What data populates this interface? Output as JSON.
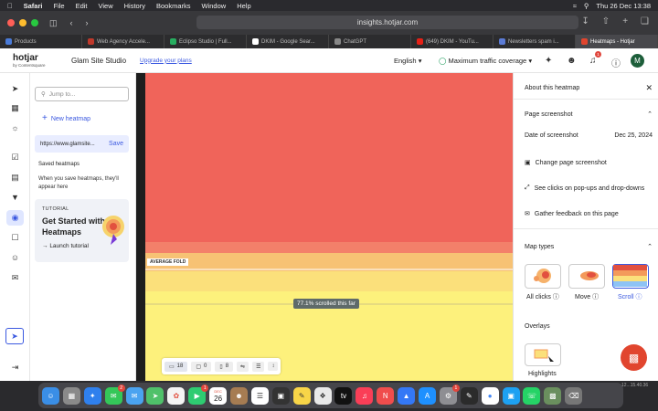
{
  "menubar": {
    "app": "Safari",
    "items": [
      "File",
      "Edit",
      "View",
      "History",
      "Bookmarks",
      "Window",
      "Help"
    ],
    "clock": "Thu 26 Dec  13:38"
  },
  "browser": {
    "url": "insights.hotjar.com",
    "tabs": [
      {
        "label": "Products",
        "color": "#4a7bd8"
      },
      {
        "label": "Web Agency Accele...",
        "color": "#c0392b"
      },
      {
        "label": "Eclipso Studio | Full...",
        "color": "#27ae60"
      },
      {
        "label": "DKIM - Google Sear...",
        "color": "#ffffff"
      },
      {
        "label": "ChatGPT",
        "color": "#888888"
      },
      {
        "label": "(649) DKIM - YouTu...",
        "color": "#e62117"
      },
      {
        "label": "Newsletters spam i...",
        "color": "#5b7bd5"
      },
      {
        "label": "Heatmaps - Hotjar",
        "color": "#e1452e"
      }
    ]
  },
  "header": {
    "logo_main": "hotjar",
    "logo_sub": "by Contentsquare",
    "site_name": "Glam Site Studio",
    "upgrade_link": "Upgrade your plans",
    "language": "English",
    "coverage": "Maximum traffic coverage",
    "notification_count": "1",
    "avatar_initial": "M"
  },
  "sidebar": {
    "search_placeholder": "Jump to...",
    "new_heatmap": "New heatmap",
    "site_url": "https://www.glamsite...",
    "save": "Save",
    "saved_title": "Saved heatmaps",
    "saved_note": "When you save heatmaps, they'll appear here",
    "tutorial_tag": "TUTORIAL",
    "tutorial_head": "Get Started with Heatmaps",
    "tutorial_launch": "Launch tutorial"
  },
  "canvas": {
    "fold_label": "AVERAGE FOLD",
    "scroll_tip": "77.1% scrolled this far",
    "devices": [
      {
        "icon": "desktop-icon",
        "count": "18"
      },
      {
        "icon": "tablet-icon",
        "count": "0"
      },
      {
        "icon": "mobile-icon",
        "count": "8"
      }
    ]
  },
  "right_panel": {
    "about": "About this heatmap",
    "page_screenshot": "Page screenshot",
    "date_label": "Date of screenshot",
    "date_value": "Dec 25, 2024",
    "change_screenshot": "Change page screenshot",
    "see_clicks": "See clicks on pop-ups and drop-downs",
    "gather_feedback": "Gather feedback on this page",
    "map_types": "Map types",
    "all_clicks": "All clicks",
    "move": "Move",
    "scroll": "Scroll",
    "overlays": "Overlays",
    "highlights": "Highlights"
  },
  "dock": {
    "calendar_day": "26",
    "calendar_month": "DEC",
    "mail_badge": "2",
    "cal_badge": "1",
    "settings_badge": "1",
    "clock_hint": "12...15.40.36"
  },
  "colors": {
    "accent": "#3b59e0",
    "scroll_red": "#f0645a",
    "scroll_orange": "#f4a06a",
    "scroll_yellow": "#fbe57b",
    "scroll_lightyellow": "#fdf17c"
  }
}
